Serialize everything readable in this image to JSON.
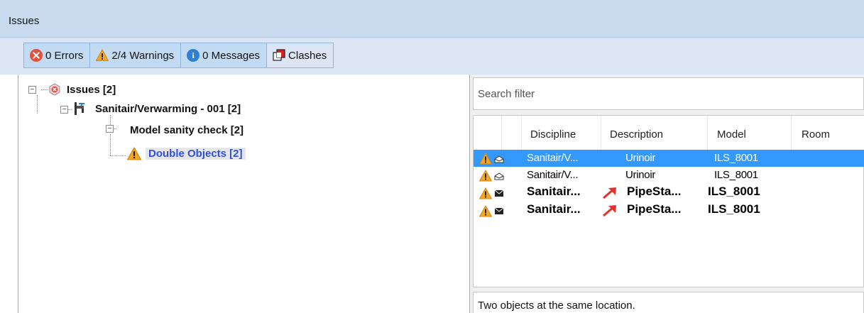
{
  "window": {
    "title": "Issues"
  },
  "toolbar": {
    "errors_label": "0 Errors",
    "warnings_label": "2/4 Warnings",
    "messages_label": "0 Messages",
    "clashes_label": "Clashes",
    "icons": [
      "error-icon",
      "warning-icon",
      "info-icon",
      "clash-icon"
    ]
  },
  "tree": {
    "root": {
      "label": "Issues [2]",
      "icon": "issues-icon"
    },
    "model": {
      "label": "Sanitair/Verwarming - 001 [2]",
      "icon": "faucet-icon"
    },
    "check": {
      "label": "Model sanity check [2]"
    },
    "leaf": {
      "label": "Double Objects [2]",
      "icon": "warning-icon"
    }
  },
  "search": {
    "placeholder": "Search filter"
  },
  "table": {
    "columns": [
      "Discipline",
      "Description",
      "Model",
      "Room"
    ],
    "rows": [
      {
        "discipline": "Sanitair/V...",
        "description": "Urinoir",
        "model": "ILS_8001",
        "room": "",
        "read": true,
        "selected": true,
        "linked": false
      },
      {
        "discipline": "Sanitair/V...",
        "description": "Urinoir",
        "model": "ILS_8001",
        "room": "",
        "read": true,
        "selected": false,
        "linked": false
      },
      {
        "discipline": "Sanitair...",
        "description": "PipeSta...",
        "model": "ILS_8001",
        "room": "",
        "read": false,
        "selected": false,
        "linked": true
      },
      {
        "discipline": "Sanitair...",
        "description": "PipeSta...",
        "model": "ILS_8001",
        "room": "",
        "read": false,
        "selected": false,
        "linked": true
      }
    ]
  },
  "status": {
    "text": "Two objects at the same location."
  },
  "colors": {
    "titlebar": "#c9d9ee",
    "toolbar": "#dbe5f3",
    "selection": "#3399ff",
    "link": "#2f4fe0",
    "warning": "#f5a623",
    "error": "#e5513b"
  }
}
